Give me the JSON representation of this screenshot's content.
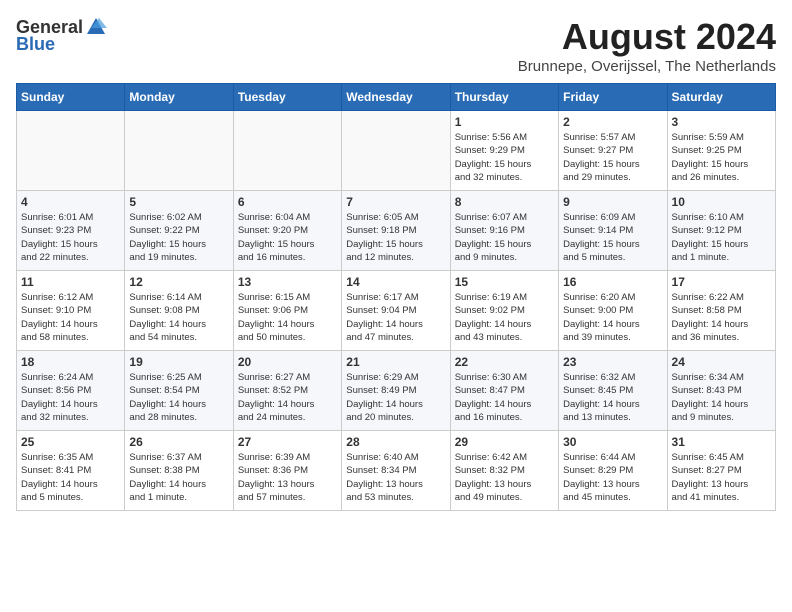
{
  "header": {
    "logo_general": "General",
    "logo_blue": "Blue",
    "month_year": "August 2024",
    "subtitle": "Brunnepe, Overijssel, The Netherlands"
  },
  "days_of_week": [
    "Sunday",
    "Monday",
    "Tuesday",
    "Wednesday",
    "Thursday",
    "Friday",
    "Saturday"
  ],
  "weeks": [
    [
      {
        "day": "",
        "info": ""
      },
      {
        "day": "",
        "info": ""
      },
      {
        "day": "",
        "info": ""
      },
      {
        "day": "",
        "info": ""
      },
      {
        "day": "1",
        "info": "Sunrise: 5:56 AM\nSunset: 9:29 PM\nDaylight: 15 hours\nand 32 minutes."
      },
      {
        "day": "2",
        "info": "Sunrise: 5:57 AM\nSunset: 9:27 PM\nDaylight: 15 hours\nand 29 minutes."
      },
      {
        "day": "3",
        "info": "Sunrise: 5:59 AM\nSunset: 9:25 PM\nDaylight: 15 hours\nand 26 minutes."
      }
    ],
    [
      {
        "day": "4",
        "info": "Sunrise: 6:01 AM\nSunset: 9:23 PM\nDaylight: 15 hours\nand 22 minutes."
      },
      {
        "day": "5",
        "info": "Sunrise: 6:02 AM\nSunset: 9:22 PM\nDaylight: 15 hours\nand 19 minutes."
      },
      {
        "day": "6",
        "info": "Sunrise: 6:04 AM\nSunset: 9:20 PM\nDaylight: 15 hours\nand 16 minutes."
      },
      {
        "day": "7",
        "info": "Sunrise: 6:05 AM\nSunset: 9:18 PM\nDaylight: 15 hours\nand 12 minutes."
      },
      {
        "day": "8",
        "info": "Sunrise: 6:07 AM\nSunset: 9:16 PM\nDaylight: 15 hours\nand 9 minutes."
      },
      {
        "day": "9",
        "info": "Sunrise: 6:09 AM\nSunset: 9:14 PM\nDaylight: 15 hours\nand 5 minutes."
      },
      {
        "day": "10",
        "info": "Sunrise: 6:10 AM\nSunset: 9:12 PM\nDaylight: 15 hours\nand 1 minute."
      }
    ],
    [
      {
        "day": "11",
        "info": "Sunrise: 6:12 AM\nSunset: 9:10 PM\nDaylight: 14 hours\nand 58 minutes."
      },
      {
        "day": "12",
        "info": "Sunrise: 6:14 AM\nSunset: 9:08 PM\nDaylight: 14 hours\nand 54 minutes."
      },
      {
        "day": "13",
        "info": "Sunrise: 6:15 AM\nSunset: 9:06 PM\nDaylight: 14 hours\nand 50 minutes."
      },
      {
        "day": "14",
        "info": "Sunrise: 6:17 AM\nSunset: 9:04 PM\nDaylight: 14 hours\nand 47 minutes."
      },
      {
        "day": "15",
        "info": "Sunrise: 6:19 AM\nSunset: 9:02 PM\nDaylight: 14 hours\nand 43 minutes."
      },
      {
        "day": "16",
        "info": "Sunrise: 6:20 AM\nSunset: 9:00 PM\nDaylight: 14 hours\nand 39 minutes."
      },
      {
        "day": "17",
        "info": "Sunrise: 6:22 AM\nSunset: 8:58 PM\nDaylight: 14 hours\nand 36 minutes."
      }
    ],
    [
      {
        "day": "18",
        "info": "Sunrise: 6:24 AM\nSunset: 8:56 PM\nDaylight: 14 hours\nand 32 minutes."
      },
      {
        "day": "19",
        "info": "Sunrise: 6:25 AM\nSunset: 8:54 PM\nDaylight: 14 hours\nand 28 minutes."
      },
      {
        "day": "20",
        "info": "Sunrise: 6:27 AM\nSunset: 8:52 PM\nDaylight: 14 hours\nand 24 minutes."
      },
      {
        "day": "21",
        "info": "Sunrise: 6:29 AM\nSunset: 8:49 PM\nDaylight: 14 hours\nand 20 minutes."
      },
      {
        "day": "22",
        "info": "Sunrise: 6:30 AM\nSunset: 8:47 PM\nDaylight: 14 hours\nand 16 minutes."
      },
      {
        "day": "23",
        "info": "Sunrise: 6:32 AM\nSunset: 8:45 PM\nDaylight: 14 hours\nand 13 minutes."
      },
      {
        "day": "24",
        "info": "Sunrise: 6:34 AM\nSunset: 8:43 PM\nDaylight: 14 hours\nand 9 minutes."
      }
    ],
    [
      {
        "day": "25",
        "info": "Sunrise: 6:35 AM\nSunset: 8:41 PM\nDaylight: 14 hours\nand 5 minutes."
      },
      {
        "day": "26",
        "info": "Sunrise: 6:37 AM\nSunset: 8:38 PM\nDaylight: 14 hours\nand 1 minute."
      },
      {
        "day": "27",
        "info": "Sunrise: 6:39 AM\nSunset: 8:36 PM\nDaylight: 13 hours\nand 57 minutes."
      },
      {
        "day": "28",
        "info": "Sunrise: 6:40 AM\nSunset: 8:34 PM\nDaylight: 13 hours\nand 53 minutes."
      },
      {
        "day": "29",
        "info": "Sunrise: 6:42 AM\nSunset: 8:32 PM\nDaylight: 13 hours\nand 49 minutes."
      },
      {
        "day": "30",
        "info": "Sunrise: 6:44 AM\nSunset: 8:29 PM\nDaylight: 13 hours\nand 45 minutes."
      },
      {
        "day": "31",
        "info": "Sunrise: 6:45 AM\nSunset: 8:27 PM\nDaylight: 13 hours\nand 41 minutes."
      }
    ]
  ]
}
